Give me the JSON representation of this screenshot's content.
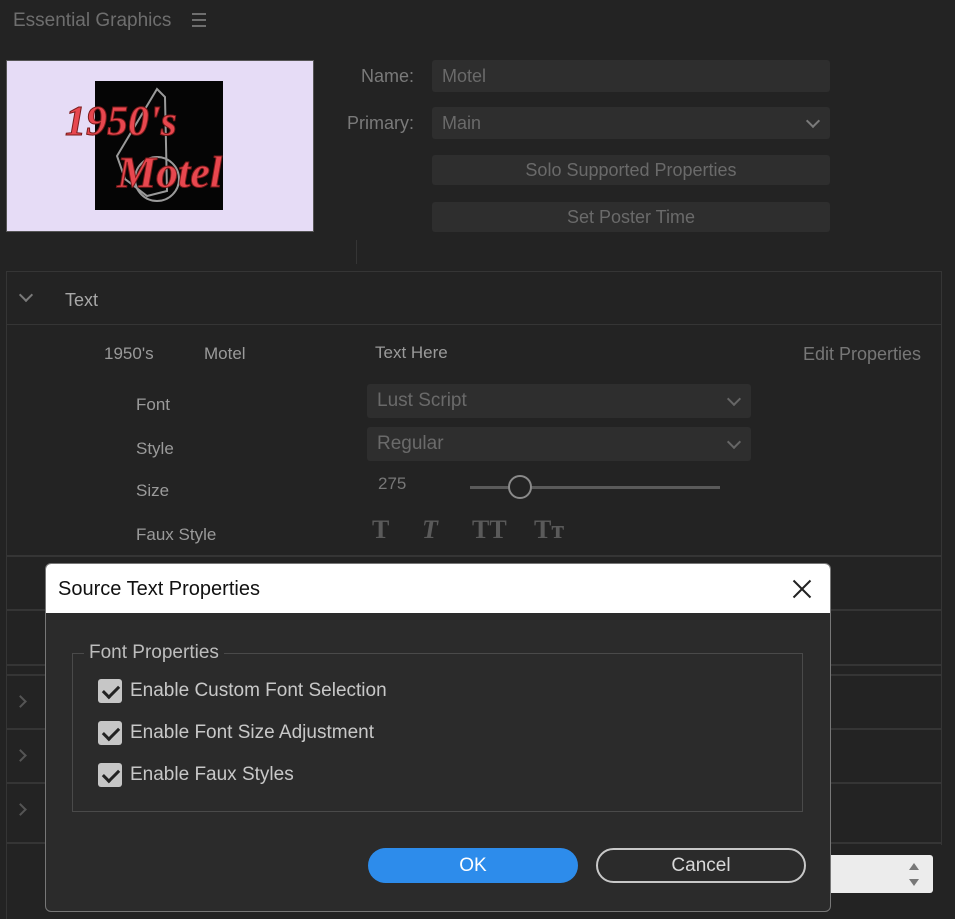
{
  "panel": {
    "title": "Essential Graphics",
    "menu_icon": "hamburger-menu-icon"
  },
  "thumbnail": {
    "line1": "1950's",
    "line2": "Motel",
    "text_color": "#e8474f",
    "background": "#e6dcf6"
  },
  "properties": {
    "name_label": "Name:",
    "name_value": "Motel",
    "primary_label": "Primary:",
    "primary_value": "Main",
    "solo_button": "Solo Supported Properties",
    "poster_button": "Set Poster Time"
  },
  "text_section": {
    "header": "Text",
    "layer1": "1950's",
    "layer2": "Motel",
    "layer3": "Text Here",
    "edit_properties": "Edit Properties",
    "font_label": "Font",
    "font_value": "Lust Script",
    "style_label": "Style",
    "style_value": "Regular",
    "size_label": "Size",
    "size_value": "275",
    "size_slider_fraction": 0.2,
    "faux_label": "Faux Style",
    "faux_buttons": [
      "T",
      "T",
      "TT",
      "Tт"
    ]
  },
  "dialog": {
    "title": "Source Text Properties",
    "group_label": "Font Properties",
    "options": [
      {
        "label": "Enable Custom Font Selection",
        "checked": true
      },
      {
        "label": "Enable Font Size Adjustment",
        "checked": true
      },
      {
        "label": "Enable Faux Styles",
        "checked": true
      }
    ],
    "ok_label": "OK",
    "cancel_label": "Cancel",
    "accent": "#2d8ceb"
  }
}
